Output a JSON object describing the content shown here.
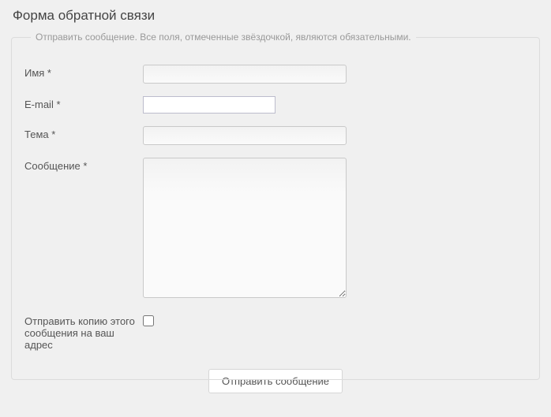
{
  "page_title": "Форма обратной связи",
  "fieldset_legend": "Отправить сообщение. Все поля, отмеченные звёздочкой, являются обязательными.",
  "fields": {
    "name_label": "Имя *",
    "email_label": "E-mail *",
    "subject_label": "Тема *",
    "message_label": "Сообщение *",
    "copy_label": "Отправить копию этого сообщения на ваш адрес",
    "name_value": "",
    "email_value": "",
    "subject_value": "",
    "message_value": ""
  },
  "submit_label": "Отправить сообщение"
}
